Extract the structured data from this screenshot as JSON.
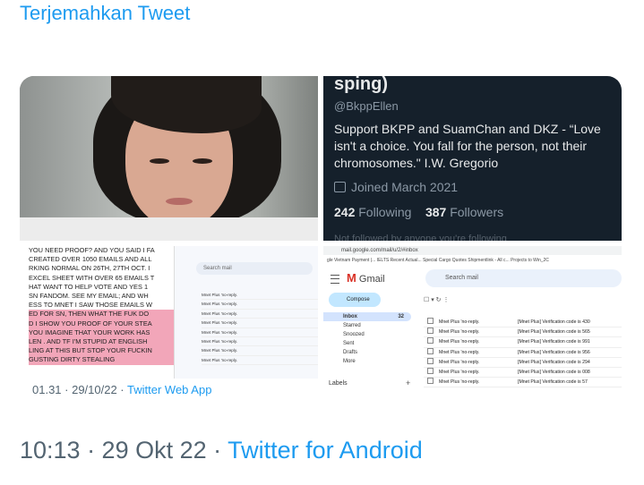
{
  "translate_label": "Terjemahkan Tweet",
  "profile": {
    "name": "sping)",
    "handle": "@BkppEllen",
    "bio": "Support BKPP and SuamChan and DKZ - “Love isn't a choice. You fall for the person, not their chromosomes.\" I.W. Gregorio",
    "joined": "Joined March 2021",
    "following_count": "242",
    "following_label": "Following",
    "followers_count": "387",
    "followers_label": "Followers",
    "more": "Not followed by anyone you're following"
  },
  "post_text_lines": [
    {
      "text": "YOU NEED PROOF? AND YOU SAID I FA",
      "hl": false
    },
    {
      "text": "CREATED OVER 1050 EMAILS AND ALL",
      "hl": false
    },
    {
      "text": "RKING NORMAL ON 26TH, 27TH OCT. I",
      "hl": false
    },
    {
      "text": "EXCEL SHEET WITH OVER 65 EMAILS T",
      "hl": false
    },
    {
      "text": "HAT WANT TO HELP VOTE AND YES 1",
      "hl": false
    },
    {
      "text": "SN FANDOM. SEE MY EMAIL; AND WH",
      "hl": false
    },
    {
      "text": "ESS TO MNET I SAW THOSE EMAILS W",
      "hl": false
    },
    {
      "text": "ED FOR SN, THEN WHAT THE FUK DO",
      "hl": true
    },
    {
      "text": "D I SHOW YOU PROOF OF YOUR STEA",
      "hl": true
    },
    {
      "text": "YOU IMAGINE THAT YOUR WORK HAS",
      "hl": true
    },
    {
      "text": "LEN . AND TF I'M STUPID AT ENGLISH",
      "hl": true
    },
    {
      "text": "LING AT THIS BUT STOP YOUR FUCKIN",
      "hl": true
    },
    {
      "text": "GUSTING DIRTY STEALING",
      "hl": true
    }
  ],
  "mini_gmail": {
    "search_placeholder": "Search mail",
    "rows": [
      "Mnet Plus 'no-reply.",
      "Mnet Plus 'no-reply.",
      "Mnet Plus 'no-reply.",
      "Mnet Plus 'no-reply.",
      "Mnet Plus 'no-reply.",
      "Mnet Plus 'no-reply.",
      "Mnet Plus 'no-reply.",
      "Mnet Plus 'no-reply."
    ]
  },
  "caption": {
    "time": "01.31 · 29/10/22 · ",
    "app": "Twitter Web App"
  },
  "gmail": {
    "url": "mail.google.com/mail/u/2/#inbox",
    "bookmarks": "gle   Vietnam Payment |...   IELTS Recent Actual...   Special Cargo Quotes   Shipmentlink - All c...   Projects to Win_2C",
    "logo": "Gmail",
    "search_placeholder": "Search mail",
    "compose": "Compose",
    "nav": [
      {
        "label": "Inbox",
        "count": "32",
        "active": true
      },
      {
        "label": "Starred",
        "count": "",
        "active": false
      },
      {
        "label": "Snoozed",
        "count": "",
        "active": false
      },
      {
        "label": "Sent",
        "count": "",
        "active": false
      },
      {
        "label": "Drafts",
        "count": "",
        "active": false
      },
      {
        "label": "More",
        "count": "",
        "active": false
      }
    ],
    "labels_heading": "Labels",
    "toolbar": "☐ ▾   ↻   ⋮",
    "rows": [
      {
        "from": "Mnet Plus 'no-reply.",
        "subject": "[Mnet Plus] Verification code is 430"
      },
      {
        "from": "Mnet Plus 'no-reply.",
        "subject": "[Mnet Plus] Verification code is 565"
      },
      {
        "from": "Mnet Plus 'no-reply.",
        "subject": "[Mnet Plus] Verification code is 991"
      },
      {
        "from": "Mnet Plus 'no-reply.",
        "subject": "[Mnet Plus] Verification code is 956"
      },
      {
        "from": "Mnet Plus 'no-reply.",
        "subject": "[Mnet Plus] Verification code is 294"
      },
      {
        "from": "Mnet Plus 'no-reply.",
        "subject": "[Mnet Plus] Verification code is 008"
      },
      {
        "from": "Mnet Plus 'no-reply.",
        "subject": "[Mnet Plus] Verification code is 57"
      }
    ]
  },
  "footer": {
    "timestamp": "10:13 · 29 Okt 22 · ",
    "source": "Twitter for Android"
  }
}
